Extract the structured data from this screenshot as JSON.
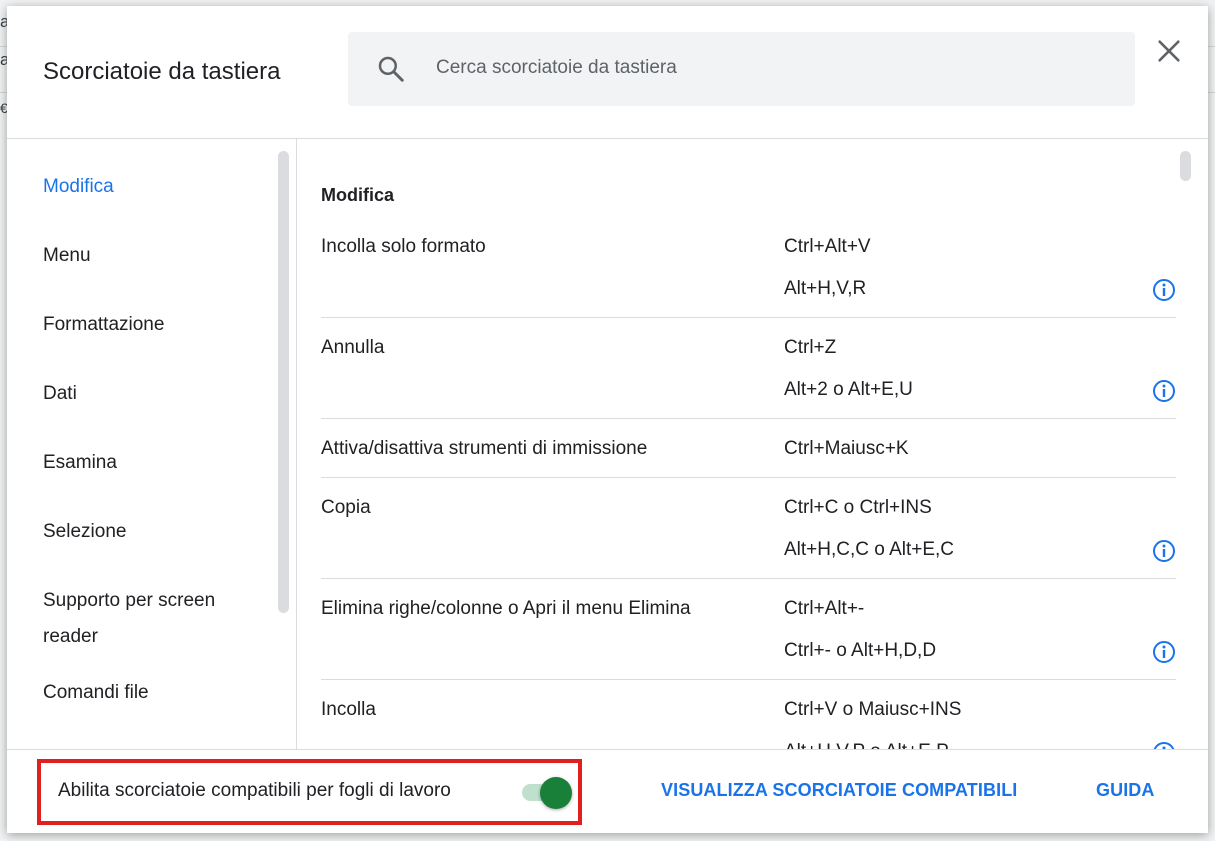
{
  "background": {
    "edge_text": [
      "a",
      "a",
      "€"
    ]
  },
  "header": {
    "title": "Scorciatoie da tastiera",
    "search_placeholder": "Cerca scorciatoie da tastiera",
    "search_icon": "search-icon",
    "close_icon": "close-icon"
  },
  "sidebar": {
    "items": [
      {
        "label": "Modifica",
        "active": true
      },
      {
        "label": "Menu"
      },
      {
        "label": "Formattazione"
      },
      {
        "label": "Dati"
      },
      {
        "label": "Esamina"
      },
      {
        "label": "Selezione"
      },
      {
        "label": "Supporto per screen",
        "label2": "reader"
      },
      {
        "label": "Comandi file"
      }
    ]
  },
  "content": {
    "section_title": "Modifica",
    "rows": [
      {
        "label": "Incolla solo formato",
        "shortcut1": "Ctrl+Alt+V",
        "shortcut2": "Alt+H,V,R",
        "info": true
      },
      {
        "label": "Annulla",
        "shortcut1": "Ctrl+Z",
        "shortcut2": "Alt+2 o Alt+E,U",
        "info": true
      },
      {
        "label": "Attiva/disattiva strumenti di immissione",
        "shortcut1": "Ctrl+Maiusc+K"
      },
      {
        "label": "Copia",
        "shortcut1": "Ctrl+C o Ctrl+INS",
        "shortcut2": "Alt+H,C,C o Alt+E,C",
        "info": true
      },
      {
        "label": "Elimina righe/colonne o Apri il menu Elimina",
        "shortcut1": "Ctrl+Alt+-",
        "shortcut2": "Ctrl+- o Alt+H,D,D",
        "info": true
      },
      {
        "label": "Incolla",
        "shortcut1": "Ctrl+V o Maiusc+INS",
        "shortcut2": "Alt+H,V,P o Alt+E,P",
        "info": true
      }
    ],
    "info_icon": "info-icon"
  },
  "footer": {
    "compat_label": "Abilita scorciatoie compatibili per fogli di lavoro",
    "toggle_on": true,
    "view_compat": "VISUALIZZA SCORCIATOIE COMPATIBILI",
    "help": "GUIDA"
  },
  "colors": {
    "accent": "#1a73e8",
    "toggle": "#188038",
    "highlight": "#e0201f"
  }
}
